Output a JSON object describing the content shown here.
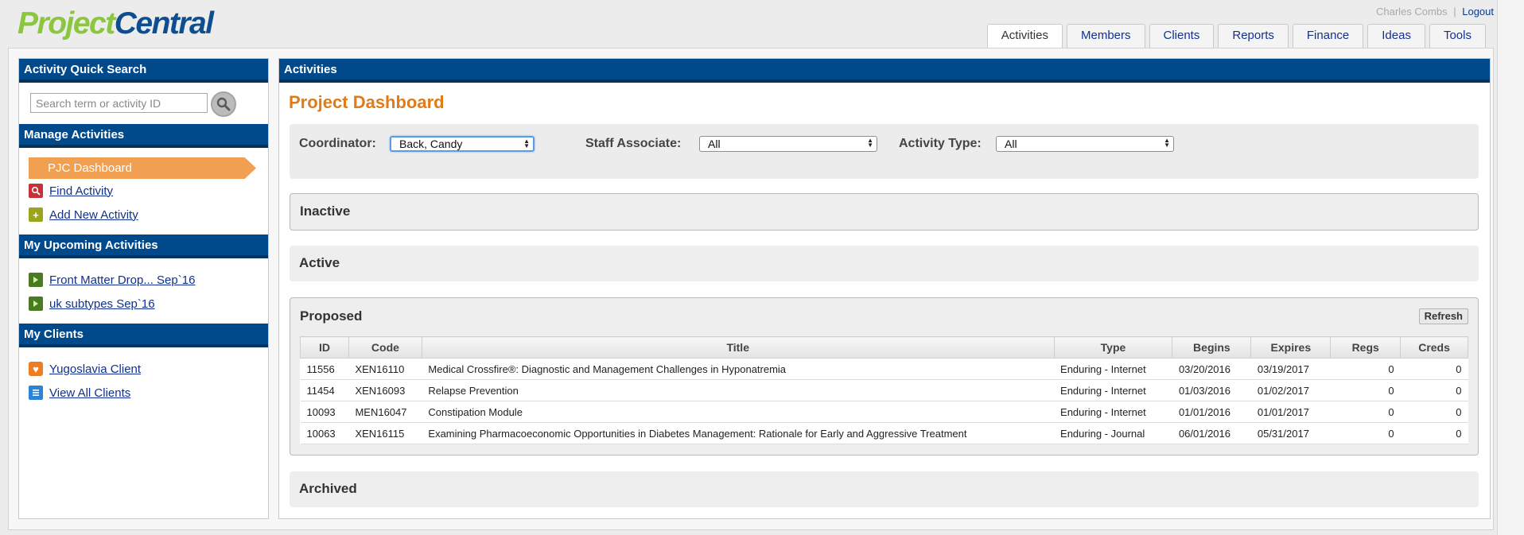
{
  "app": {
    "logo_part1": "Project",
    "logo_part2": "Central",
    "user_name": "Charles Combs",
    "separator": "|",
    "logout": "Logout"
  },
  "tabs": [
    {
      "label": "Activities",
      "active": true
    },
    {
      "label": "Members",
      "active": false
    },
    {
      "label": "Clients",
      "active": false
    },
    {
      "label": "Reports",
      "active": false
    },
    {
      "label": "Finance",
      "active": false
    },
    {
      "label": "Ideas",
      "active": false
    },
    {
      "label": "Tools",
      "active": false
    }
  ],
  "sidebar": {
    "quick_search": {
      "title": "Activity Quick Search",
      "placeholder": "Search term or activity ID"
    },
    "manage": {
      "title": "Manage Activities",
      "dashboard": "PJC Dashboard",
      "find": "Find Activity",
      "add": "Add New Activity"
    },
    "upcoming": {
      "title": "My Upcoming Activities",
      "items": [
        "Front Matter Drop... Sep`16",
        "uk subtypes Sep`16"
      ]
    },
    "clients": {
      "title": "My Clients",
      "client": "Yugoslavia Client",
      "view_all": "View All Clients"
    }
  },
  "main": {
    "header": "Activities",
    "title": "Project Dashboard",
    "filters": {
      "coordinator_label": "Coordinator:",
      "coordinator_value": "Back, Candy",
      "staff_label": "Staff Associate:",
      "staff_value": "All",
      "type_label": "Activity Type:",
      "type_value": "All"
    },
    "sections": {
      "inactive": "Inactive",
      "active": "Active",
      "proposed": "Proposed",
      "archived": "Archived"
    },
    "refresh": "Refresh",
    "table": {
      "columns": [
        "ID",
        "Code",
        "Title",
        "Type",
        "Begins",
        "Expires",
        "Regs",
        "Creds"
      ],
      "rows": [
        [
          "11556",
          "XEN16110",
          "Medical Crossfire®: Diagnostic and Management Challenges in Hyponatremia",
          "Enduring - Internet",
          "03/20/2016",
          "03/19/2017",
          "0",
          "0"
        ],
        [
          "11454",
          "XEN16093",
          "Relapse Prevention",
          "Enduring - Internet",
          "01/03/2016",
          "01/02/2017",
          "0",
          "0"
        ],
        [
          "10093",
          "MEN16047",
          "Constipation Module",
          "Enduring - Internet",
          "01/01/2016",
          "01/01/2017",
          "0",
          "0"
        ],
        [
          "10063",
          "XEN16115",
          "Examining Pharmacoeconomic Opportunities in Diabetes Management: Rationale for Early and Aggressive Treatment",
          "Enduring - Journal",
          "06/01/2016",
          "05/31/2017",
          "0",
          "0"
        ]
      ]
    }
  },
  "colors": {
    "header_blue": "#004a8c",
    "title_orange": "#e07b1a",
    "dashboard_orange": "#f0a050",
    "logo_green": "#8cc63f",
    "logo_blue": "#0e4d8f"
  }
}
